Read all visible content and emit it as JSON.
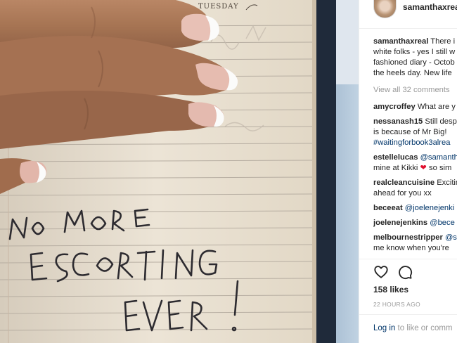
{
  "photo": {
    "diary_day": "TUESDAY",
    "handwriting_lines": [
      "NO MORE",
      "ESCORTING",
      "EVER!"
    ]
  },
  "post": {
    "username": "samanthaxreal",
    "caption_lines": [
      {
        "user": "samanthaxreal",
        "text": "There i"
      },
      {
        "user": "",
        "text": "white folks - yes I still w"
      },
      {
        "user": "",
        "text": "fashioned diary - Octob"
      },
      {
        "user": "",
        "text": "the heels day. New life"
      }
    ],
    "view_all_comments": "View all 32 comments",
    "comments": [
      {
        "user": "amycroffey",
        "lines": [
          "What are y"
        ]
      },
      {
        "user": "nessanash15",
        "lines": [
          "Still desp",
          "is because of Mr Big!",
          "#waitingforbook3alrea"
        ]
      },
      {
        "user": "estellelucas",
        "lines": [
          "@samanth",
          "mine at Kikki",
          "so sim"
        ]
      },
      {
        "user": "realcleancuisine",
        "lines": [
          "Excitin",
          "ahead for you xx"
        ]
      },
      {
        "user": "beceeat",
        "lines": [
          "@joelenejenki"
        ]
      },
      {
        "user": "joelenejenkins",
        "lines": [
          "@bece"
        ]
      },
      {
        "user": "melbournestripper",
        "lines": [
          "@s",
          "me know when you're"
        ]
      }
    ],
    "likes": "158 likes",
    "time_ago": "22 HOURS AGO",
    "login_link": "Log in",
    "login_suffix": "to like or comm"
  },
  "colors": {
    "accent_link": "#003569",
    "muted_text": "#999999",
    "text": "#262626",
    "heart_red": "#e0102f"
  },
  "icons": [
    "heart-icon",
    "comment-bubble-icon"
  ]
}
